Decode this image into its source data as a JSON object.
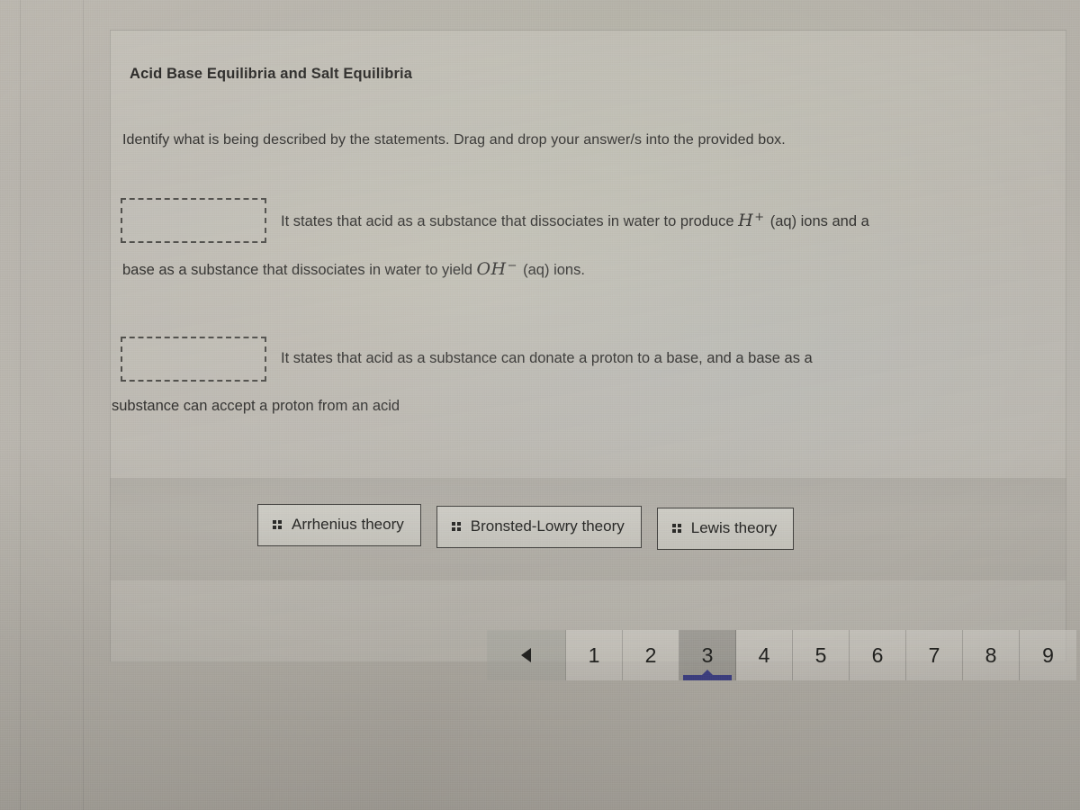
{
  "quiz": {
    "title": "Acid Base Equilibria and Salt Equilibria",
    "instructions": "Identify what is being described by the statements. Drag and drop your answer/s into the provided box."
  },
  "statements": [
    {
      "id": "statement-1",
      "dropbox_value": "",
      "text_before": "It states that acid as a substance that dissociates in water to produce",
      "formula_1_var": "H",
      "formula_1_sup": "+",
      "text_mid": "(aq) ions and a",
      "text_wrap_before": "base as a substance that dissociates in water to yield",
      "formula_2_var": "OH",
      "formula_2_sup": "−",
      "text_wrap_after": "(aq) ions."
    },
    {
      "id": "statement-2",
      "dropbox_value": "",
      "text_before": "It states that acid as a substance can donate a proton to a base, and a base as a",
      "text_wrap": "substance can accept a proton from an acid"
    }
  ],
  "answer_bank": {
    "handle_icon": "drag-handle-icon",
    "chips": [
      {
        "label": "Arrhenius theory"
      },
      {
        "label": "Bronsted-Lowry theory"
      },
      {
        "label": "Lewis theory"
      }
    ]
  },
  "pagination": {
    "prev_icon": "triangle-left-icon",
    "prev_label": "◀",
    "active_page": "3",
    "pages": [
      "1",
      "2",
      "3",
      "4",
      "5",
      "6",
      "7",
      "8",
      "9"
    ]
  },
  "colors": {
    "accent": "#3c3f86",
    "text": "#2c2b29",
    "card_border": "#3f3e3b",
    "dropbox_border": "#4a4945"
  }
}
